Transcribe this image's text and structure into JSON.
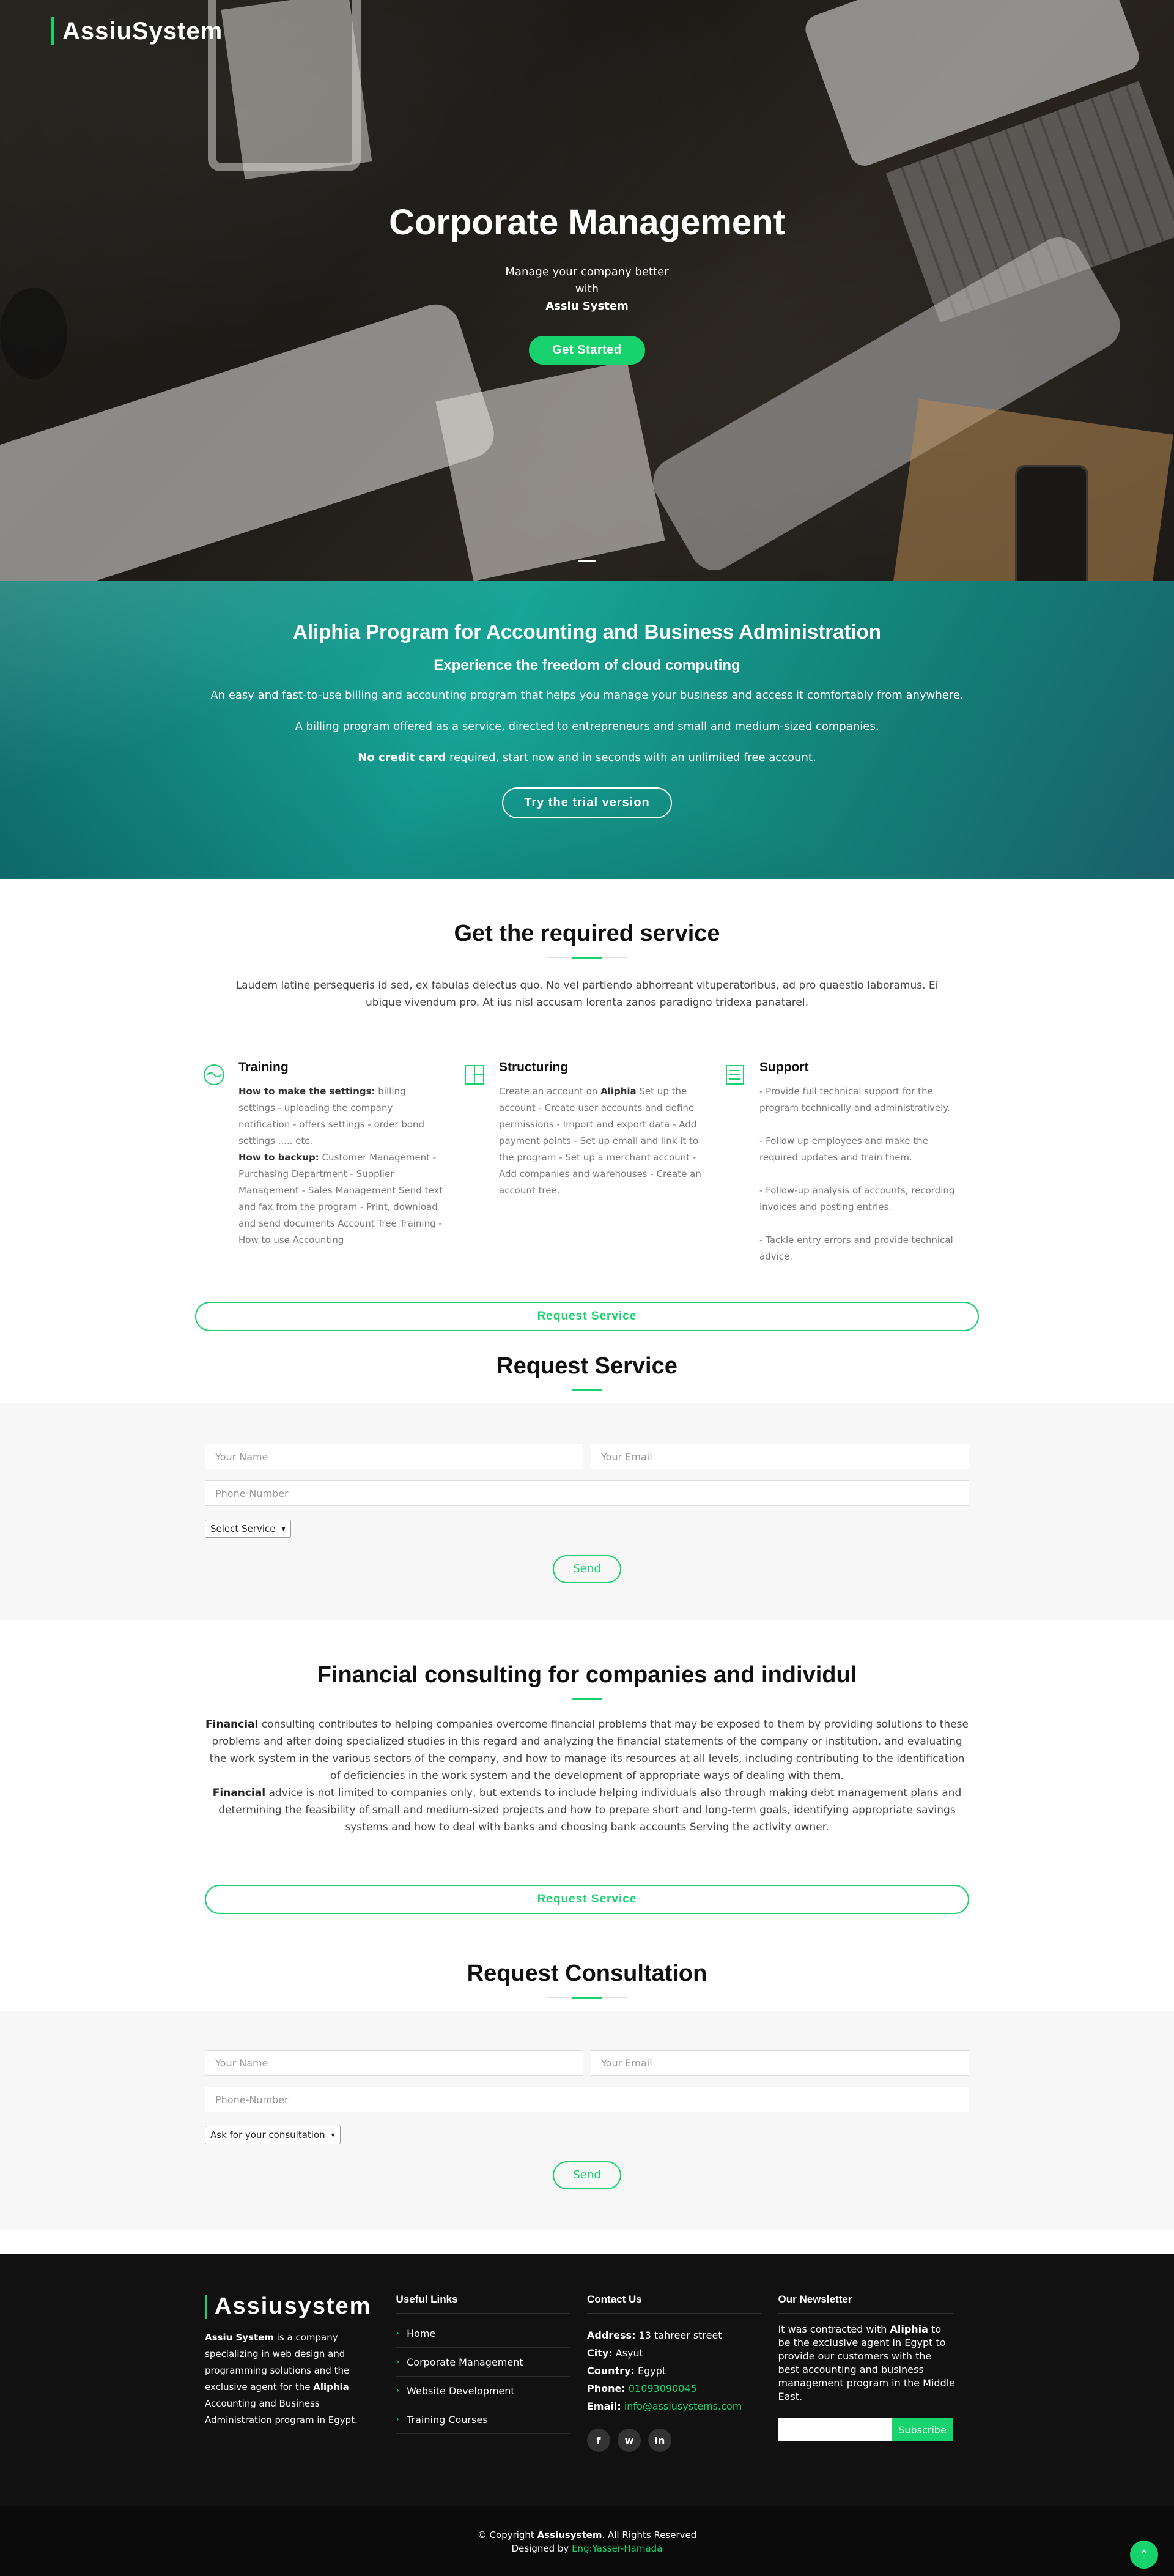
{
  "brand": {
    "name": "AssiuSystem"
  },
  "hero": {
    "title": "Corporate Management",
    "line1": "Manage your company better",
    "line2": "with",
    "line3": "Assiu System",
    "cta": "Get Started"
  },
  "banner": {
    "title": "Aliphia Program for Accounting and Business Administration",
    "subtitle": "Experience the freedom of cloud computing",
    "p1": "An easy and fast-to-use billing and accounting program that helps you manage your business and access it comfortably from anywhere.",
    "p2": "A billing program offered as a service, directed to entrepreneurs and small and medium-sized companies.",
    "p3_bold": "No credit card",
    "p3_rest": " required, start now and in seconds with an unlimited free account.",
    "cta": "Try the trial version"
  },
  "services": {
    "title": "Get the required service",
    "lead": "Laudem latine persequeris id sed, ex fabulas delectus quo. No vel partiendo abhorreant vituperatoribus, ad pro quaestio laboramus. Ei ubique vivendum pro. At ius nisl accusam lorenta zanos paradigno tridexa panatarel.",
    "items": [
      {
        "icon": "wave-icon",
        "title": "Training",
        "b1": "How to make the settings:",
        "t1": " billing settings - uploading the company notification - offers settings - order bond settings ..... etc.",
        "b2": "How to backup:",
        "t2": " Customer Management - Purchasing Department - Supplier Management - Sales Management Send text and fax from the program - Print, download and send documents Account Tree Training - How to use Accounting"
      },
      {
        "icon": "layout-icon",
        "title": "Structuring",
        "t1": "Create an account on ",
        "b1": "Aliphia",
        "t2": " Set up the account - Create user accounts and define permissions - Import and export data - Add payment points - Set up email and link it to the program - Set up a merchant account - Add companies and warehouses - Create an account tree."
      },
      {
        "icon": "list-icon",
        "title": "Support",
        "lines": [
          "- Provide full technical support for the program technically and administratively.",
          "- Follow up employees and make the required updates and train them.",
          "- Follow-up analysis of accounts, recording invoices and posting entries.",
          "- Tackle entry errors and provide technical advice."
        ]
      }
    ],
    "request_button": "Request Service"
  },
  "request_service": {
    "title": "Request Service",
    "name_placeholder": "Your Name",
    "email_placeholder": "Your Email",
    "phone_placeholder": "Phone-Number",
    "select_value": "Select Service",
    "send": "Send"
  },
  "financial": {
    "title": "Financial consulting for companies and individul",
    "p1_bold": "Financial",
    "p1_rest": " consulting contributes to helping companies overcome financial problems that may be exposed to them by providing solutions to these problems and after doing specialized studies in this regard and analyzing the financial statements of the company or institution, and evaluating the work system in the various sectors of the company, and how to manage its resources at all levels, including contributing to the identification of deficiencies in the work system and the development of appropriate ways of dealing with them.",
    "p2_bold": "Financial",
    "p2_rest": " advice is not limited to companies only, but extends to include helping individuals also through making debt management plans and determining the feasibility of small and medium-sized projects and how to prepare short and long-term goals, identifying appropriate savings systems and how to deal with banks and choosing bank accounts Serving the activity owner.",
    "request_button": "Request Service"
  },
  "consultation": {
    "title": "Request Consultation",
    "name_placeholder": "Your Name",
    "email_placeholder": "Your Email",
    "phone_placeholder": "Phone-Number",
    "select_value": "Ask for your consultation",
    "send": "Send"
  },
  "footer": {
    "logo": "Assiusystem",
    "about_bold": "Assiu System",
    "about_rest1": " is a company specializing in web design and programming solutions and the exclusive agent for the ",
    "about_bold2": "Aliphia",
    "about_rest2": " Accounting and Business Administration program in Egypt.",
    "links_title": "Useful Links",
    "links": [
      "Home",
      "Corporate Management",
      "Website Development",
      "Training Courses"
    ],
    "contact_title": "Contact Us",
    "address_label": "Address:",
    "address": " 13 tahreer street",
    "city_label": "City:",
    "city": " Asyut",
    "country_label": "Country:",
    "country": " Egypt",
    "phone_label": "Phone:",
    "phone": " 01093090045",
    "email_label": "Email:",
    "email": " info@assiusystems.com",
    "newsletter_title": "Our Newsletter",
    "news_1": "It was contracted with ",
    "news_bold": "Aliphia",
    "news_2": " to be the exclusive agent in Egypt to provide our customers with the best accounting and business management program in the Middle East.",
    "subscribe": "Subscribe",
    "social": [
      "f",
      "w",
      "in"
    ]
  },
  "copyright": {
    "pre": "© Copyright ",
    "bold": "Assiusystem",
    "post": ". All Rights Reserved",
    "designed_pre": "Designed by ",
    "designer": "Eng:Yasser-Hamada"
  },
  "colors": {
    "accent": "#18d26e",
    "footer": "#111111",
    "banner": "#16a596"
  }
}
